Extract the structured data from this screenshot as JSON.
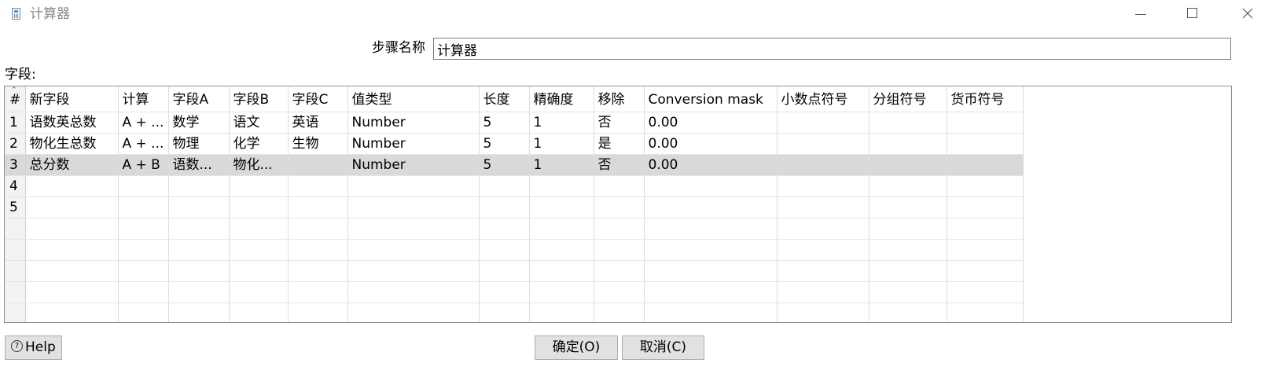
{
  "window": {
    "title": "计算器",
    "icon": "calculator-icon",
    "controls": [
      "minimize-icon",
      "maximize-icon",
      "close-icon"
    ]
  },
  "step": {
    "label": "步骤名称",
    "value": "计算器"
  },
  "fields_label": "字段:",
  "table": {
    "columns": [
      "#",
      "新字段",
      "计算",
      "字段A",
      "字段B",
      "字段C",
      "值类型",
      "长度",
      "精确度",
      "移除",
      "Conversion mask",
      "小数点符号",
      "分组符号",
      "货币符号"
    ],
    "rows": [
      [
        "1",
        "语数英总数",
        "A + ...",
        "数学",
        "语文",
        "英语",
        "Number",
        "5",
        "1",
        "否",
        "0.00",
        "",
        "",
        ""
      ],
      [
        "2",
        "物化生总数",
        "A + ...",
        "物理",
        "化学",
        "生物",
        "Number",
        "5",
        "1",
        "是",
        "0.00",
        "",
        "",
        ""
      ],
      [
        "3",
        "总分数",
        "A + B",
        "语数...",
        "物化...",
        "",
        "Number",
        "5",
        "1",
        "否",
        "0.00",
        "",
        "",
        ""
      ],
      [
        "4",
        "",
        "",
        "",
        "",
        "",
        "",
        "",
        "",
        "",
        "",
        "",
        "",
        ""
      ],
      [
        "5",
        "",
        "",
        "",
        "",
        "",
        "",
        "",
        "",
        "",
        "",
        "",
        "",
        ""
      ],
      [
        "",
        "",
        "",
        "",
        "",
        "",
        "",
        "",
        "",
        "",
        "",
        "",
        "",
        ""
      ],
      [
        "",
        "",
        "",
        "",
        "",
        "",
        "",
        "",
        "",
        "",
        "",
        "",
        "",
        ""
      ],
      [
        "",
        "",
        "",
        "",
        "",
        "",
        "",
        "",
        "",
        "",
        "",
        "",
        "",
        ""
      ],
      [
        "",
        "",
        "",
        "",
        "",
        "",
        "",
        "",
        "",
        "",
        "",
        "",
        "",
        ""
      ],
      [
        "",
        "",
        "",
        "",
        "",
        "",
        "",
        "",
        "",
        "",
        "",
        "",
        "",
        ""
      ]
    ],
    "selected_row": 3
  },
  "buttons": {
    "help": "Help",
    "help_icon": "help-circle-icon",
    "ok": "确定(O)",
    "cancel": "取消(C)"
  },
  "colors": {
    "selected_row": "#d9d9d9",
    "title_text": "#8a8a8a",
    "button_bg": "#e1e1e1"
  }
}
